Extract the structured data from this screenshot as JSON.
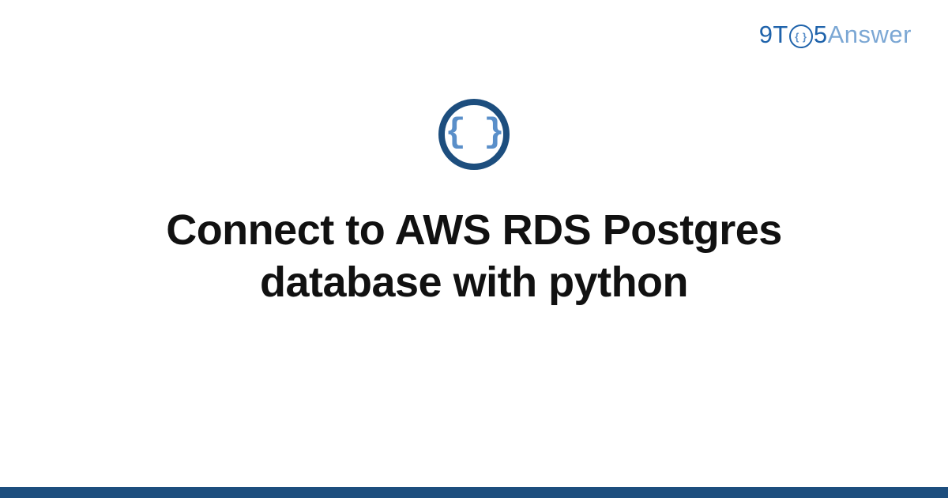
{
  "brand": {
    "prefix": "9T",
    "circle_glyph": "{ }",
    "mid": "5",
    "suffix": "Answer"
  },
  "badge": {
    "glyph": "{ }"
  },
  "title": "Connect to AWS RDS Postgres database with python",
  "colors": {
    "brand_primary": "#1f63ab",
    "brand_light": "#7ba7d4",
    "badge_border": "#1d4e7e",
    "badge_text": "#5a8fc9",
    "footer": "#1d4e7e"
  }
}
